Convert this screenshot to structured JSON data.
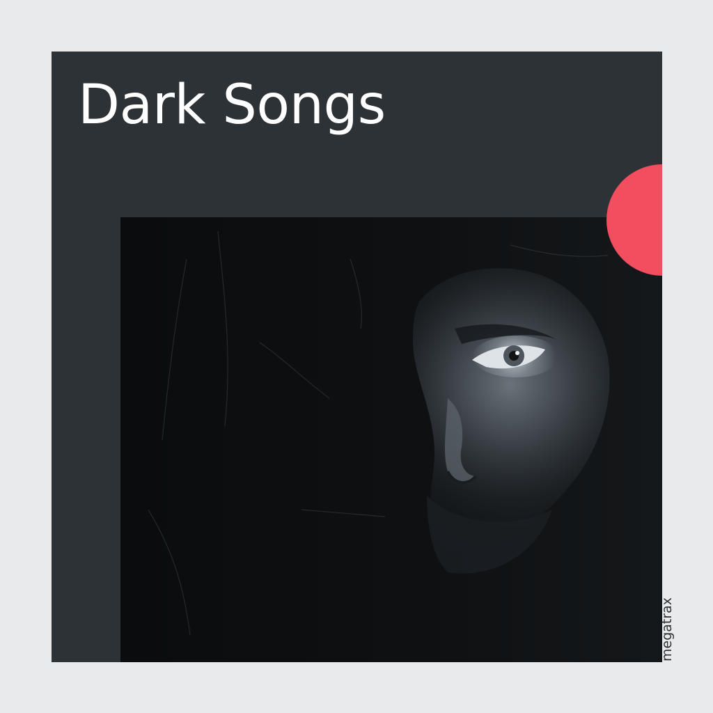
{
  "cover": {
    "title": "Dark Songs",
    "brand": "megatrax"
  },
  "colors": {
    "background": "#e9eaeb",
    "panel": "#2c3236",
    "accent": "#f24e5f",
    "title_text": "#ffffff",
    "brand_text": "#2c3236"
  },
  "image": {
    "subject": "half-shadowed face of a man with a piercing eye on a dark, scratched background"
  }
}
